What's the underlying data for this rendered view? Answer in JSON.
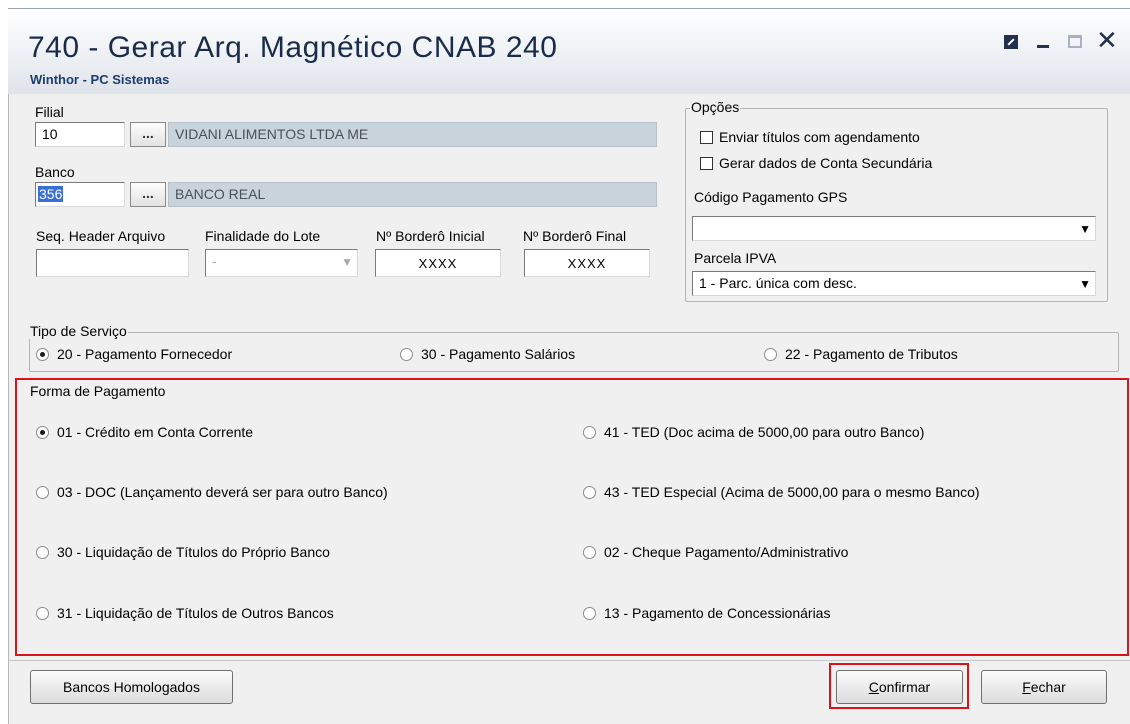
{
  "window": {
    "title": "740 - Gerar Arq. Magnético CNAB 240",
    "subtitle": "Winthor - PC Sistemas",
    "close_glyph": "✕"
  },
  "filial": {
    "label": "Filial",
    "code": "10",
    "lookup_label": "...",
    "name": "VIDANI ALIMENTOS LTDA ME"
  },
  "banco": {
    "label": "Banco",
    "code": "356",
    "lookup_label": "...",
    "name": "BANCO REAL"
  },
  "fields": {
    "seq_header_label": "Seq. Header Arquivo",
    "seq_header_value": "",
    "finalidade_label": "Finalidade do Lote",
    "finalidade_value": "-",
    "bordero_inicial_label": "Nº Borderô Inicial",
    "bordero_inicial_value": "XXXX",
    "bordero_final_label": "Nº Borderô Final",
    "bordero_final_value": "XXXX"
  },
  "opcoes": {
    "title": "Opções",
    "enviar_titulos": "Enviar títulos com agendamento",
    "gerar_dados": "Gerar dados de Conta Secundária",
    "gps_label": "Código Pagamento GPS",
    "gps_value": "",
    "ipva_label": "Parcela IPVA",
    "ipva_value": "1 - Parc. única com desc."
  },
  "tipo_servico": {
    "title": "Tipo de Serviço",
    "opt_20": "20 - Pagamento Fornecedor",
    "opt_30": "30 - Pagamento Salários",
    "opt_22": "22 - Pagamento de Tributos",
    "selected": "20"
  },
  "forma_pagamento": {
    "title": "Forma de Pagamento",
    "opt_01": "01 - Crédito em Conta Corrente",
    "opt_03": "03 - DOC (Lançamento deverá ser para outro Banco)",
    "opt_30": "30 - Liquidação de Títulos do Próprio Banco",
    "opt_31": "31 - Liquidação de Títulos de Outros Bancos",
    "opt_41": "41 - TED (Doc acima de 5000,00 para outro Banco)",
    "opt_43": "43 - TED Especial (Acima de 5000,00 para o mesmo Banco)",
    "opt_02": "02 - Cheque Pagamento/Administrativo",
    "opt_13": "13 - Pagamento de Concessionárias",
    "selected": "01"
  },
  "buttons": {
    "bancos_homologados": "Bancos Homologados",
    "confirmar_first": "C",
    "confirmar_rest": "onfirmar",
    "fechar_first": "F",
    "fechar_rest": "echar"
  },
  "colors": {
    "highlight_frame": "#d9141a",
    "title_text": "#1b2c4a"
  }
}
